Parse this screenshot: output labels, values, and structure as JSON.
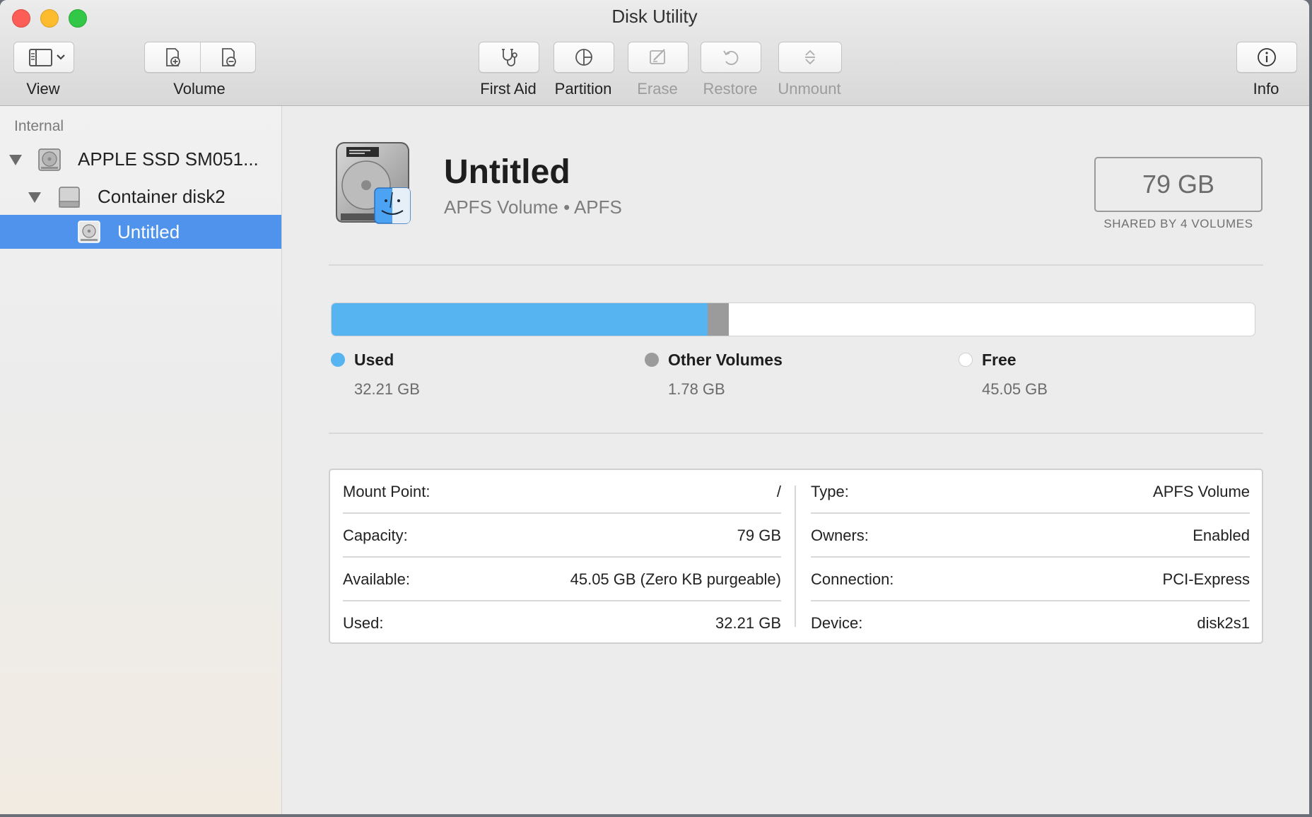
{
  "window": {
    "title": "Disk Utility"
  },
  "toolbar": {
    "view_label": "View",
    "volume_label": "Volume",
    "first_aid_label": "First Aid",
    "partition_label": "Partition",
    "erase_label": "Erase",
    "restore_label": "Restore",
    "unmount_label": "Unmount",
    "info_label": "Info"
  },
  "sidebar": {
    "section_header": "Internal",
    "items": [
      {
        "label": "APPLE SSD SM051...",
        "icon": "disk-icon"
      },
      {
        "label": "Container disk2",
        "icon": "container-icon"
      },
      {
        "label": "Untitled",
        "icon": "volume-icon",
        "selected": true
      }
    ]
  },
  "volume": {
    "name": "Untitled",
    "subtitle": "APFS Volume • APFS",
    "size": "79 GB",
    "size_caption": "SHARED BY 4 VOLUMES"
  },
  "usage": {
    "used": {
      "label": "Used",
      "value": "32.21 GB",
      "gb": 32.21,
      "color": "#56b4f0"
    },
    "other": {
      "label": "Other Volumes",
      "value": "1.78 GB",
      "gb": 1.78,
      "color": "#9b9b9b"
    },
    "free": {
      "label": "Free",
      "value": "45.05 GB",
      "gb": 45.05,
      "color": "#ffffff"
    }
  },
  "details": {
    "left": [
      {
        "key": "Mount Point:",
        "value": "/"
      },
      {
        "key": "Capacity:",
        "value": "79 GB"
      },
      {
        "key": "Available:",
        "value": "45.05 GB (Zero KB purgeable)"
      },
      {
        "key": "Used:",
        "value": "32.21 GB"
      }
    ],
    "right": [
      {
        "key": "Type:",
        "value": "APFS Volume"
      },
      {
        "key": "Owners:",
        "value": "Enabled"
      },
      {
        "key": "Connection:",
        "value": "PCI-Express"
      },
      {
        "key": "Device:",
        "value": "disk2s1"
      }
    ]
  }
}
